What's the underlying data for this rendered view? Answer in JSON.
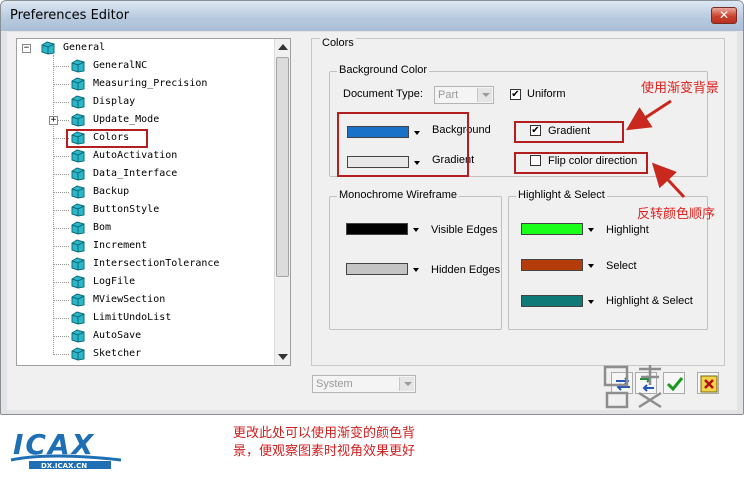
{
  "window": {
    "title": "Preferences Editor",
    "close_glyph": "✕"
  },
  "tree": {
    "root": {
      "label": "General",
      "expander": "−"
    },
    "items": [
      {
        "label": "GeneralNC"
      },
      {
        "label": "Measuring_Precision"
      },
      {
        "label": "Display"
      },
      {
        "label": "Update_Mode",
        "expander": "+"
      },
      {
        "label": "Colors",
        "selected": true
      },
      {
        "label": "AutoActivation"
      },
      {
        "label": "Data_Interface"
      },
      {
        "label": "Backup"
      },
      {
        "label": "ButtonStyle"
      },
      {
        "label": "Bom"
      },
      {
        "label": "Increment"
      },
      {
        "label": "IntersectionTolerance"
      },
      {
        "label": "LogFile"
      },
      {
        "label": "MViewSection"
      },
      {
        "label": "LimitUndoList"
      },
      {
        "label": "AutoSave"
      },
      {
        "label": "Sketcher"
      }
    ]
  },
  "colors_panel": {
    "title": "Colors",
    "background_group": {
      "title": "Background Color",
      "document_type_label": "Document Type:",
      "document_type_value": "Part",
      "uniform_label": "Uniform",
      "uniform_checked": "✔",
      "background_label": "Background",
      "background_color": "#1a72c8",
      "gradient_label": "Gradient",
      "gradient_color": "#e8e8e8",
      "gradient_checkbox_label": "Gradient",
      "gradient_checked": "✔",
      "flip_label": "Flip color direction"
    },
    "wireframe_group": {
      "title": "Monochrome Wireframe",
      "visible_edges_label": "Visible Edges",
      "visible_edges_color": "#000000",
      "hidden_edges_label": "Hidden Edges",
      "hidden_edges_color": "#c4c4c4"
    },
    "highlight_group": {
      "title": "Highlight & Select",
      "highlight_label": "Highlight",
      "highlight_color": "#19ff19",
      "select_label": "Select",
      "select_color": "#b43c0a",
      "highlight_select_label": "Highlight & Select",
      "highlight_select_color": "#0e7a78"
    }
  },
  "bottom": {
    "system_combo": "System"
  },
  "annotations": {
    "gradient_note": "使用渐变背景",
    "flip_note": "反转颜色顺序",
    "bottom_note_line1": "更改此处可以使用渐变的颜色背",
    "bottom_note_line2": "景，便观察图素时视角效果更好"
  },
  "logo": {
    "text": "ICAX",
    "subtext": "DX.ICAX.CN"
  },
  "accent_colors": {
    "annotation_red": "#e2201c",
    "box_red": "#b41e1e",
    "logo_blue": "#1f6fb5"
  }
}
